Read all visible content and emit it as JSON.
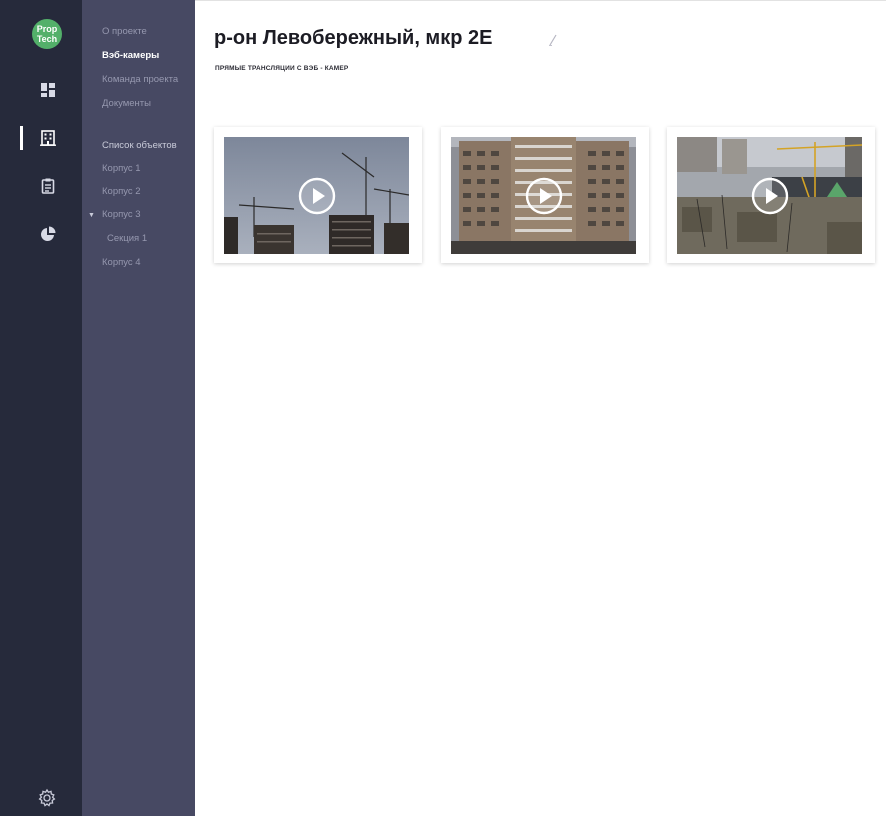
{
  "app": {
    "logo_line1": "Prop",
    "logo_line2": "Tech"
  },
  "rail": {
    "icons": [
      "dashboard-icon",
      "building-icon",
      "clipboard-icon",
      "pie-chart-icon"
    ],
    "active": "building-icon",
    "bottom_icon": "gear-icon"
  },
  "subnav": {
    "top_items": [
      {
        "label": "О проекте"
      },
      {
        "label": "Вэб-камеры",
        "active": true
      },
      {
        "label": "Команда проекта"
      },
      {
        "label": "Документы"
      }
    ],
    "objects_title": "Список объектов",
    "objects": [
      {
        "label": "Корпус 1"
      },
      {
        "label": "Корпус 2"
      },
      {
        "label": "Корпус 3",
        "expanded": true
      },
      {
        "label": "Секция 1",
        "child": true
      },
      {
        "label": "Корпус 4"
      }
    ]
  },
  "main": {
    "title": "р-он Левобережный, мкр 2E",
    "subtitle": "ПРЯМЫЕ ТРАНСЛЯЦИИ С ВЭБ - КАМЕР",
    "cameras": [
      {
        "thumbnail": "construction-cranes-sky",
        "icon": "play-icon"
      },
      {
        "thumbnail": "apartment-building-facade",
        "icon": "play-icon"
      },
      {
        "thumbnail": "construction-site-crane",
        "icon": "play-icon"
      }
    ]
  },
  "colors": {
    "rail_bg": "#262a3b",
    "subnav_bg": "#474963",
    "logo_green": "#53b06a",
    "active_text": "#ffffff",
    "inactive_text": "#9698af"
  }
}
